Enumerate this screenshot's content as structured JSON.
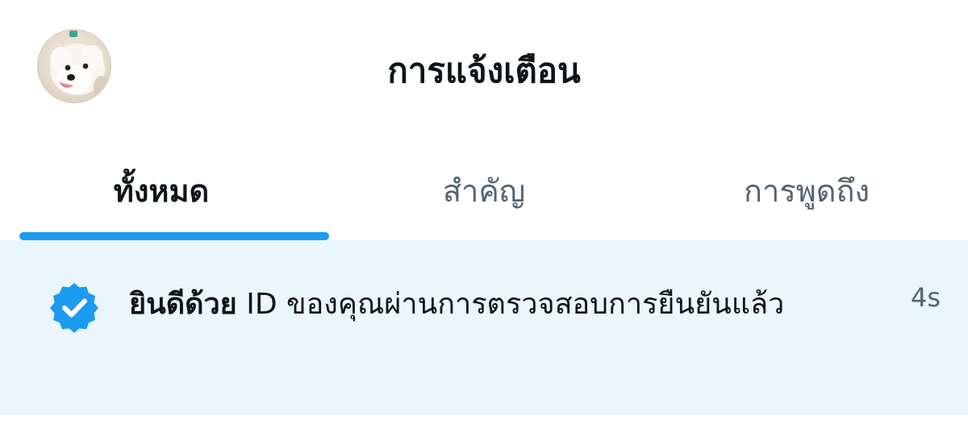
{
  "header": {
    "title": "การแจ้งเตือน",
    "avatar_icon": "dog-avatar"
  },
  "tabs": [
    {
      "label": "ทั้งหมด",
      "active": true
    },
    {
      "label": "สำคัญ",
      "active": false
    },
    {
      "label": "การพูดถึง",
      "active": false
    }
  ],
  "notification": {
    "icon": "verified-badge-icon",
    "bold_text": "ยินดีด้วย",
    "text": " ID ของคุณผ่านการตรวจสอบการยืนยันแล้ว",
    "time": "4s"
  },
  "colors": {
    "accent": "#1d9bf0",
    "text": "#0f1419",
    "secondary_text": "#536471",
    "notification_bg": "#eaf6fc"
  }
}
